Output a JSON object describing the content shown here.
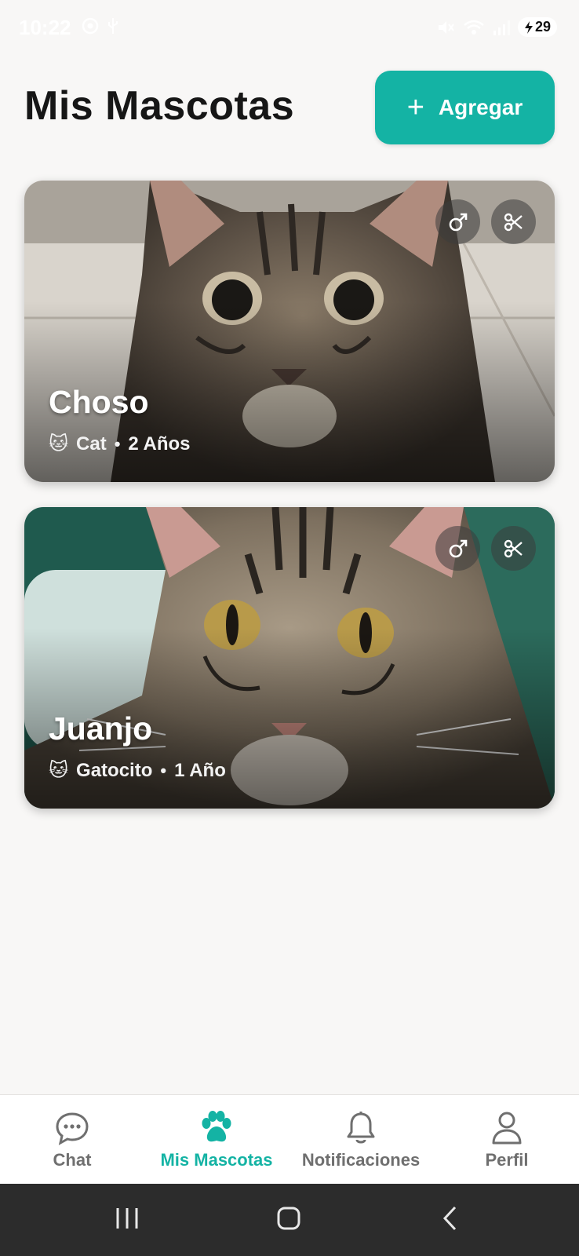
{
  "status_bar": {
    "time": "10:22",
    "battery": "29",
    "icons_left": [
      "screen-record-icon",
      "usb-icon"
    ],
    "icons_right": [
      "mute-icon",
      "wifi-icon",
      "signal-icon",
      "battery-icon"
    ]
  },
  "header": {
    "title": "Mis Mascotas",
    "add_button_label": "Agregar",
    "add_icon": "+"
  },
  "colors": {
    "accent": "#14b3a4",
    "background": "#f8f7f6",
    "nav_inactive": "#6f6f6f",
    "system_bar": "#2c2c2c"
  },
  "pets": [
    {
      "name": "Choso",
      "species_icon": "🐱",
      "species": "Cat",
      "separator": "•",
      "age": "2 Años",
      "badges": [
        "male-icon",
        "neutered-scissors-icon"
      ]
    },
    {
      "name": "Juanjo",
      "species_icon": "🐱",
      "species": "Gatocito",
      "separator": "•",
      "age": "1 Año",
      "badges": [
        "male-icon",
        "neutered-scissors-icon"
      ]
    }
  ],
  "bottom_nav": {
    "active": "Mis Mascotas",
    "items": [
      {
        "label": "Chat",
        "icon": "chat-bubble-icon"
      },
      {
        "label": "Mis Mascotas",
        "icon": "paw-icon"
      },
      {
        "label": "Notificaciones",
        "icon": "bell-icon"
      },
      {
        "label": "Perfil",
        "icon": "user-icon"
      }
    ]
  },
  "system_nav": [
    "recents-icon",
    "home-icon",
    "back-icon"
  ]
}
